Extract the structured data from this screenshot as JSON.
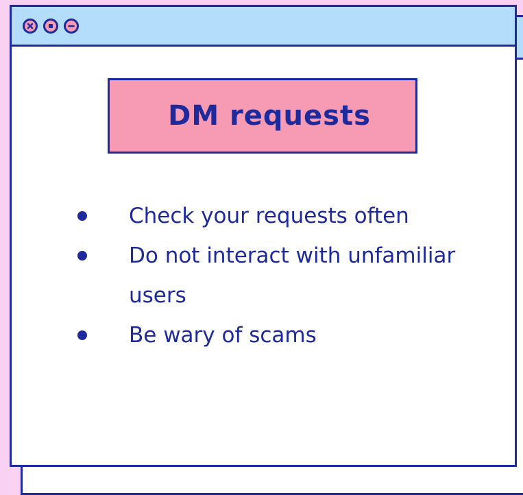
{
  "colors": {
    "background": "#f9d2f3",
    "titlebar": "#b3ddfb",
    "accent_pink": "#f79ab4",
    "ink": "#1e2a9b",
    "window": "#ffffff"
  },
  "window": {
    "controls": [
      {
        "icon": "close-icon"
      },
      {
        "icon": "stop-icon"
      },
      {
        "icon": "minimize-icon"
      }
    ]
  },
  "slide": {
    "title": "DM requests",
    "bullets": [
      "Check your requests often",
      "Do not interact with unfamiliar users",
      "Be wary of scams"
    ]
  }
}
